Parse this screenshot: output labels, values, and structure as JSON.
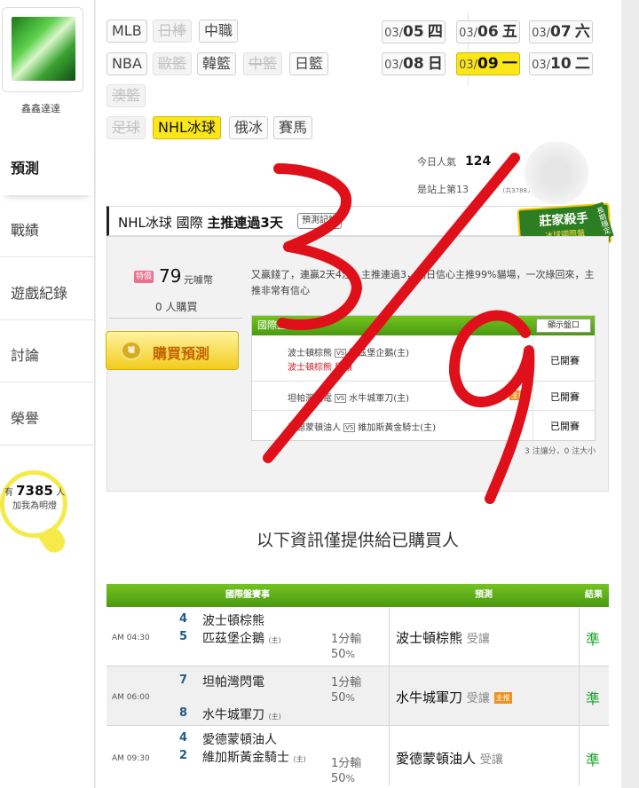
{
  "sidebar": {
    "username": "鑫鑫達達",
    "nav": [
      {
        "label": "預測",
        "active": true
      },
      {
        "label": "戰績",
        "active": false
      },
      {
        "label": "遊戲紀錄",
        "active": false
      },
      {
        "label": "討論",
        "active": false
      },
      {
        "label": "榮譽",
        "active": false
      }
    ],
    "lamp": {
      "prefix": "有",
      "count": "7385",
      "suffix": "人",
      "caption": "加我為明燈"
    }
  },
  "leagues": [
    {
      "label": "MLB",
      "state": "normal"
    },
    {
      "label": "日棒",
      "state": "disabled"
    },
    {
      "label": "中職",
      "state": "normal"
    },
    {
      "label": "NBA",
      "state": "normal"
    },
    {
      "label": "歐籃",
      "state": "disabled"
    },
    {
      "label": "韓籃",
      "state": "normal"
    },
    {
      "label": "中籃",
      "state": "disabled"
    },
    {
      "label": "日籃",
      "state": "normal"
    },
    {
      "label": "澳籃",
      "state": "disabled"
    },
    {
      "label": "足球",
      "state": "disabled"
    },
    {
      "label": "NHL冰球",
      "state": "active"
    },
    {
      "label": "俄冰",
      "state": "normal"
    },
    {
      "label": "賽馬",
      "state": "normal"
    }
  ],
  "dates": [
    {
      "md": "03/",
      "day": "05",
      "wd": "四",
      "active": false
    },
    {
      "md": "03/",
      "day": "06",
      "wd": "五",
      "active": false
    },
    {
      "md": "03/",
      "day": "07",
      "wd": "六",
      "active": false
    },
    {
      "md": "03/",
      "day": "08",
      "wd": "日",
      "active": false
    },
    {
      "md": "03/",
      "day": "09",
      "wd": "一",
      "active": true
    },
    {
      "md": "03/",
      "day": "10",
      "wd": "二",
      "active": false
    }
  ],
  "stats": {
    "today_label": "今日人氣",
    "today_value": "124",
    "rank_text": "是站上第13",
    "rank_tail": "！",
    "rank_total": "(共3788人)"
  },
  "badge": {
    "title": "莊家殺手",
    "sub": "冰球國際盤",
    "ribbon": "長期穩定"
  },
  "section": {
    "title_prefix": "NHL冰球 國際",
    "title_bold": "主推連過3天",
    "record_btn": "預測記錄"
  },
  "price": {
    "tag": "特價",
    "amount": "79",
    "unit": "元噱幣",
    "buyers": "0 人購買",
    "buy_label": "購買預測",
    "coin": "噱"
  },
  "description": "又贏錢了，連贏2天4注，主推連過3，明日信心主推99%貓場，一次綠回來，主推非常有信心",
  "intl": {
    "header": "國際盤",
    "show_btn": "顯示盤口",
    "rows": [
      {
        "away": "波士頓棕熊",
        "home": "匹茲堡企鵝(主)",
        "pick": "波士頓棕熊 受讓",
        "status": "已開賽"
      },
      {
        "away": "坦帕灣閃電",
        "home": "水牛城軍刀(主)",
        "icon": "主推",
        "status": "已開賽"
      },
      {
        "away": "愛德蒙頓油人",
        "home": "維加斯黃金騎士(主)",
        "status": "已開賽"
      }
    ],
    "note": "3 注讓分，0 注大小"
  },
  "info_msg": "以下資訊僅提供給已購買人",
  "table": {
    "headers": [
      "國際盤賽事",
      "預測",
      "結果"
    ],
    "rows": [
      {
        "time": "AM 04:30",
        "n1": "4",
        "t1": "波士頓棕熊",
        "n2": "5",
        "t2": "匹茲堡企鵝",
        "home": "(主)",
        "line": "1分輸",
        "pct": "50",
        "pct_unit": "%",
        "pick": "波士頓棕熊",
        "pick_sub": "受讓",
        "result": "準"
      },
      {
        "time": "AM 06:00",
        "n1": "7",
        "t1": "坦帕灣閃電",
        "n2": "8",
        "t2": "水牛城軍刀",
        "home": "(主)",
        "line": "1分輸",
        "pct": "50",
        "pct_unit": "%",
        "pick": "水牛城軍刀",
        "pick_sub": "受讓",
        "pick_icon": "主推",
        "result": "準"
      },
      {
        "time": "AM 09:30",
        "n1": "4",
        "t1": "愛德蒙頓油人",
        "n2": "2",
        "t2": "維加斯黃金騎士",
        "home": "(主)",
        "line": "1分輸",
        "pct": "50",
        "pct_unit": "%",
        "pick": "愛德蒙頓油人",
        "pick_sub": "受讓",
        "result": "準"
      }
    ]
  },
  "handwriting": "3/9",
  "colors": {
    "accent_yellow": "#fbe619",
    "green_header": "#5aac18",
    "red_mark": "#e0101a",
    "result_green": "#1aa52a"
  }
}
